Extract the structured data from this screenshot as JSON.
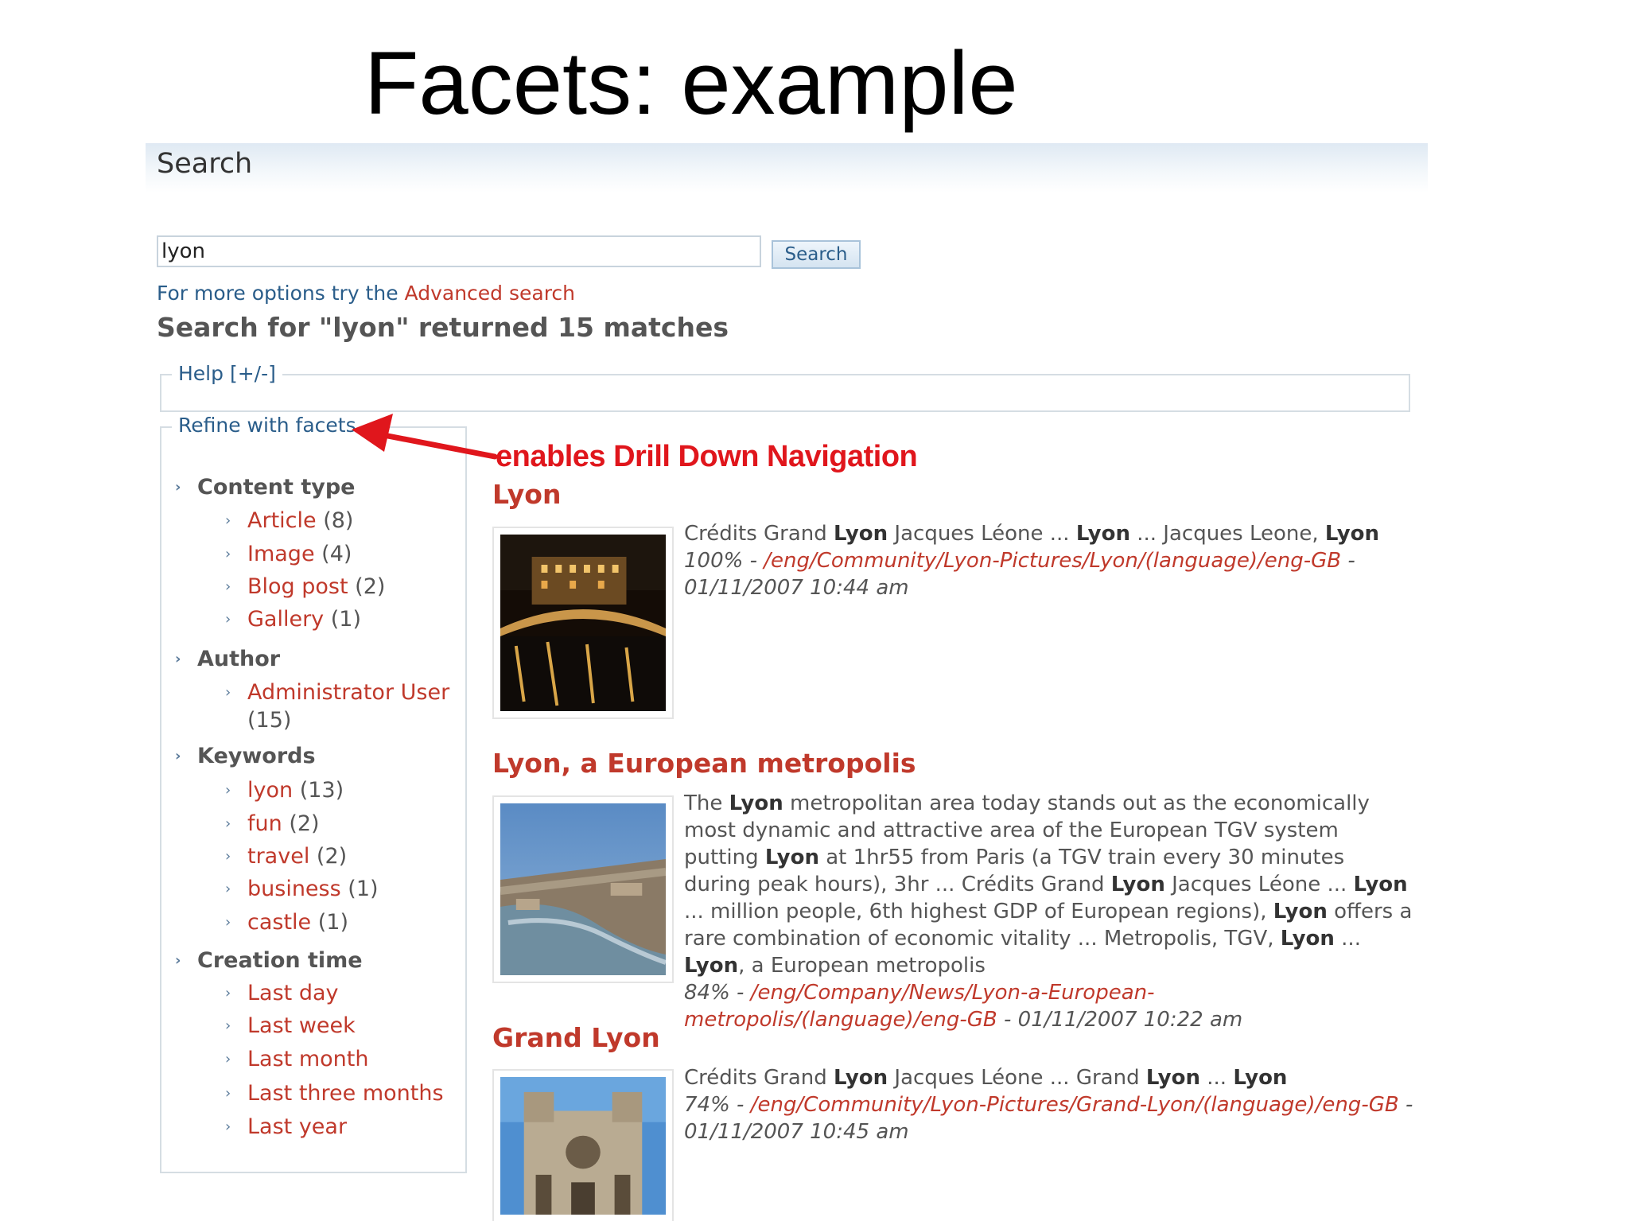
{
  "slide": {
    "title": "Facets: example"
  },
  "search": {
    "heading": "Search",
    "query": "lyon",
    "button_label": "Search",
    "more_options_prefix": "For more options try the ",
    "advanced_link": "Advanced search",
    "summary": "Search for \"lyon\" returned 15 matches"
  },
  "help": {
    "legend": "Help [+/-]"
  },
  "facets": {
    "legend": "Refine with facets",
    "groups": [
      {
        "label": "Content type",
        "items": [
          {
            "label": "Article",
            "count": "(8)"
          },
          {
            "label": "Image",
            "count": "(4)"
          },
          {
            "label": "Blog post",
            "count": "(2)"
          },
          {
            "label": "Gallery",
            "count": "(1)"
          }
        ]
      },
      {
        "label": "Author",
        "items": [
          {
            "label": "Administrator User",
            "count": "(15)"
          }
        ]
      },
      {
        "label": "Keywords",
        "items": [
          {
            "label": "lyon",
            "count": "(13)"
          },
          {
            "label": "fun",
            "count": "(2)"
          },
          {
            "label": "travel",
            "count": "(2)"
          },
          {
            "label": "business",
            "count": "(1)"
          },
          {
            "label": "castle",
            "count": "(1)"
          }
        ]
      },
      {
        "label": "Creation time",
        "items": [
          {
            "label": "Last day"
          },
          {
            "label": "Last week"
          },
          {
            "label": "Last month"
          },
          {
            "label": "Last three months"
          },
          {
            "label": "Last year"
          }
        ]
      }
    ]
  },
  "annotation": {
    "text": "enables Drill Down Navigation",
    "color": "#e0161c"
  },
  "results": [
    {
      "title": "Lyon",
      "thumbnail_icon": "night-bridge-photo",
      "snippet_parts": [
        {
          "text": "Crédits Grand ",
          "bold": false
        },
        {
          "text": "Lyon",
          "bold": true
        },
        {
          "text": " Jacques Léone ... ",
          "bold": false
        },
        {
          "text": "Lyon",
          "bold": true
        },
        {
          "text": " ... Jacques Leone, ",
          "bold": false
        },
        {
          "text": "Lyon",
          "bold": true
        }
      ],
      "score": "100% - ",
      "url": "/eng/Community/Lyon-Pictures/Lyon/(language)/eng-GB",
      "date": " - 01/11/2007 10:44 am"
    },
    {
      "title": "Lyon, a European metropolis",
      "thumbnail_icon": "aerial-city-photo",
      "snippet_parts": [
        {
          "text": "The ",
          "bold": false
        },
        {
          "text": "Lyon",
          "bold": true
        },
        {
          "text": " metropolitan area today stands out as the economically most dynamic and attractive area of the European TGV system putting ",
          "bold": false
        },
        {
          "text": "Lyon",
          "bold": true
        },
        {
          "text": " at 1hr55 from Paris (a TGV train every 30 minutes during peak hours), 3hr ... Crédits Grand ",
          "bold": false
        },
        {
          "text": "Lyon",
          "bold": true
        },
        {
          "text": " Jacques Léone ... ",
          "bold": false
        },
        {
          "text": "Lyon",
          "bold": true
        },
        {
          "text": " ... million people, 6th highest GDP of European regions), ",
          "bold": false
        },
        {
          "text": "Lyon",
          "bold": true
        },
        {
          "text": " offers a rare combination of economic vitality ... Metropolis, TGV, ",
          "bold": false
        },
        {
          "text": "Lyon",
          "bold": true
        },
        {
          "text": " ... ",
          "bold": false
        },
        {
          "text": "Lyon",
          "bold": true
        },
        {
          "text": ", a European metropolis",
          "bold": false
        }
      ],
      "score": "84% - ",
      "url": "/eng/Company/News/Lyon-a-European-metropolis/(language)/eng-GB",
      "date": " - 01/11/2007 10:22 am"
    },
    {
      "title": "Grand Lyon",
      "thumbnail_icon": "cathedral-photo",
      "snippet_parts": [
        {
          "text": "Crédits Grand ",
          "bold": false
        },
        {
          "text": "Lyon",
          "bold": true
        },
        {
          "text": " Jacques Léone ... Grand ",
          "bold": false
        },
        {
          "text": "Lyon",
          "bold": true
        },
        {
          "text": " ... ",
          "bold": false
        },
        {
          "text": "Lyon",
          "bold": true
        }
      ],
      "score": "74% - ",
      "url": "/eng/Community/Lyon-Pictures/Grand-Lyon/(language)/eng-GB",
      "date": " - 01/11/2007 10:45 am"
    }
  ]
}
